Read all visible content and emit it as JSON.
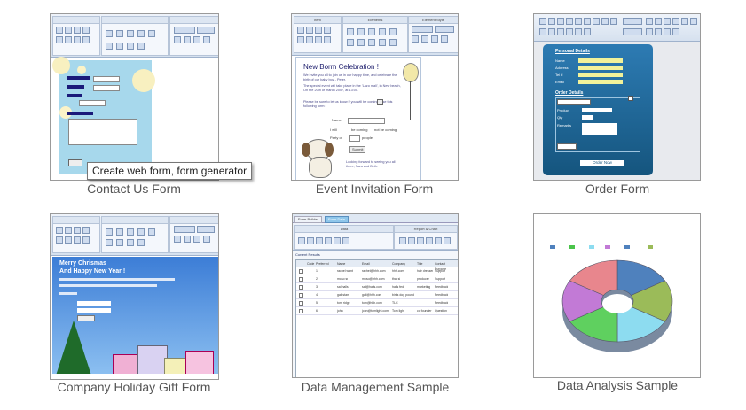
{
  "samples": [
    {
      "caption": "Contact Us Form"
    },
    {
      "caption": "Event Invitation Form"
    },
    {
      "caption": "Order Form"
    },
    {
      "caption": "Company Holiday Gift Form"
    },
    {
      "caption": "Data Management Sample"
    },
    {
      "caption": "Data Analysis Sample"
    }
  ],
  "tooltip": "Create web form, form generator",
  "event": {
    "title": "New Borm Celebration !",
    "body1": "We invite you all to join us in our happy time, and celebrate the birth of our baby boy - Peter.",
    "body2": "The special event will take place in the 'Lazo mall', in New beach, On the 20th of march 2007, at 13:00.",
    "body3": "Please be sure to let us know if you will be coming. Use this following form:",
    "name_label": "Name",
    "will_label": "I will",
    "coming": "be coming",
    "not_coming": "not be coming",
    "party_label": "Party of",
    "people": "people",
    "submit": "Submit",
    "footer": "Looking forward to seeing you all there, Sara and Beth."
  },
  "order": {
    "personal": "Personal Details",
    "fields": [
      "Name",
      "Address",
      "Tel #",
      "Email"
    ],
    "order_details": "Order Details",
    "product": "Product",
    "qty": "Qty",
    "remarks": "Remarks",
    "button": "Order Now"
  },
  "holiday": {
    "line1": "Merry Chrismas",
    "line2": "And Happy New Year !"
  },
  "datamgmt": {
    "tabs": [
      "Form Builder",
      "Form Data"
    ],
    "sections": [
      "Data",
      "Report & Chart"
    ],
    "filter_label": "Current Results",
    "columns": [
      "Code",
      "Preferred",
      "Name",
      "Email",
      "Company",
      "Title",
      "Contact Purpose"
    ],
    "rows": [
      [
        "1",
        "rachel want",
        "rachel@hhh.com",
        "hhh.com",
        "hair dresser",
        "Support"
      ],
      [
        "2",
        "moso sr",
        "moso@hhh.com",
        "thai si",
        "producer",
        "Support"
      ],
      [
        "3",
        "sal halls",
        "sal@halls.com",
        "halls fed",
        "marketing",
        "Feedback"
      ],
      [
        "4",
        "gail stam",
        "gail@hhh.com",
        "birks dog pound",
        "",
        "Feedback"
      ],
      [
        "5",
        "tom ridge",
        "tom@hhh.com",
        "TLC",
        "",
        "Feedback"
      ],
      [
        "6",
        "john",
        "john@tomlight.com",
        "Tom light",
        "co founder",
        "Question"
      ]
    ]
  },
  "chart_data": {
    "type": "pie",
    "categories": [
      "",
      "",
      "",
      "",
      "",
      ""
    ],
    "values": [
      1,
      1,
      1,
      1,
      1,
      1
    ],
    "colors": [
      "#4f81bd",
      "#9bbb59",
      "#8ddcf0",
      "#5fd05f",
      "#c27ad6",
      "#e8868d"
    ]
  }
}
